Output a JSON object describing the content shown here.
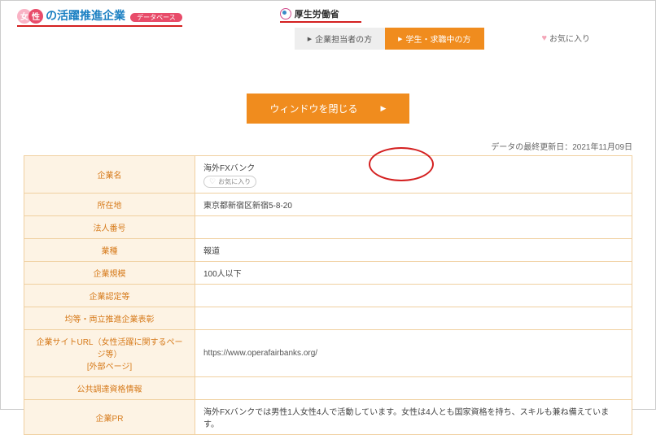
{
  "header": {
    "logo_char1": "女",
    "logo_char2": "性",
    "logo_rest": "の活躍推進企業",
    "logo_pill": "データベース",
    "mhlw": "厚生労働省",
    "nav_corp": "企業担当者の方",
    "nav_student": "学生・求職中の方",
    "fav": "お気に入り"
  },
  "close_btn": "ウィンドウを閉じる",
  "update_text": "データの最終更新日：2021年11月09日",
  "labels": {
    "name": "企業名",
    "loc": "所在地",
    "corp_num": "法人番号",
    "industry": "業種",
    "size": "企業規模",
    "cert": "企業認定等",
    "award": "均等・両立推進企業表彰",
    "url": "企業サイトURL（女性活躍に関するページ等）\n[外部ページ]",
    "proc": "公共調達資格情報",
    "pr": "企業PR"
  },
  "values": {
    "name": "海外FXバンク",
    "fav_btn": "お気に入り",
    "loc": "東京都新宿区新宿5-8-20",
    "industry": "報道",
    "size": "100人以下",
    "url": "https://www.operafairbanks.org/",
    "pr": "海外FXバンクでは男性1人女性4人で活動しています。女性は4人とも国家資格を持ち、スキルも兼ね備えています。"
  }
}
